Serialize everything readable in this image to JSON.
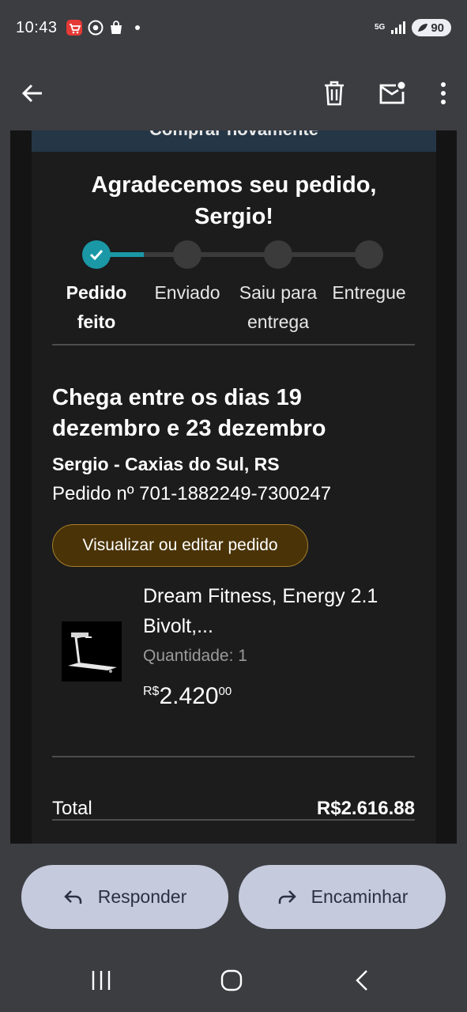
{
  "status_bar": {
    "time": "10:43",
    "network": "5G",
    "battery": "90"
  },
  "app_bar": {
    "back_icon": "arrow-left-icon",
    "delete_icon": "trash-icon",
    "unread_icon": "mark-unread-icon",
    "more_icon": "more-vert-icon"
  },
  "email": {
    "buy_again_label": "Comprar novamente",
    "thanks_line1": "Agradecemos seu pedido,",
    "thanks_line2": "Sergio!",
    "tracker": {
      "steps": [
        {
          "line1": "Pedido",
          "line2": "feito",
          "done": true
        },
        {
          "line1": "Enviado",
          "line2": "",
          "done": false
        },
        {
          "line1": "Saiu para",
          "line2": "entrega",
          "done": false
        },
        {
          "line1": "Entregue",
          "line2": "",
          "done": false
        }
      ]
    },
    "arrival_line1": "Chega entre os dias 19",
    "arrival_line2": "dezembro e 23 dezembro",
    "address": "Sergio - Caxias do Sul, RS",
    "order_number": "Pedido nº 701-1882249-7300247",
    "view_order_button": "Visualizar ou editar pedido",
    "product": {
      "name_line1": "Dream Fitness, Energy 2.1",
      "name_line2": "Bivolt,...",
      "quantity": "Quantidade: 1",
      "price_currency": "R$",
      "price_main": "2.420",
      "price_cents": "00"
    },
    "total_label": "Total",
    "total_value": "R$2.616.88"
  },
  "actions": {
    "reply_label": "Responder",
    "forward_label": "Encaminhar"
  },
  "colors": {
    "accent_teal": "#1a98a6",
    "button_gold": "#4a3306",
    "action_button": "#c5cadd"
  }
}
